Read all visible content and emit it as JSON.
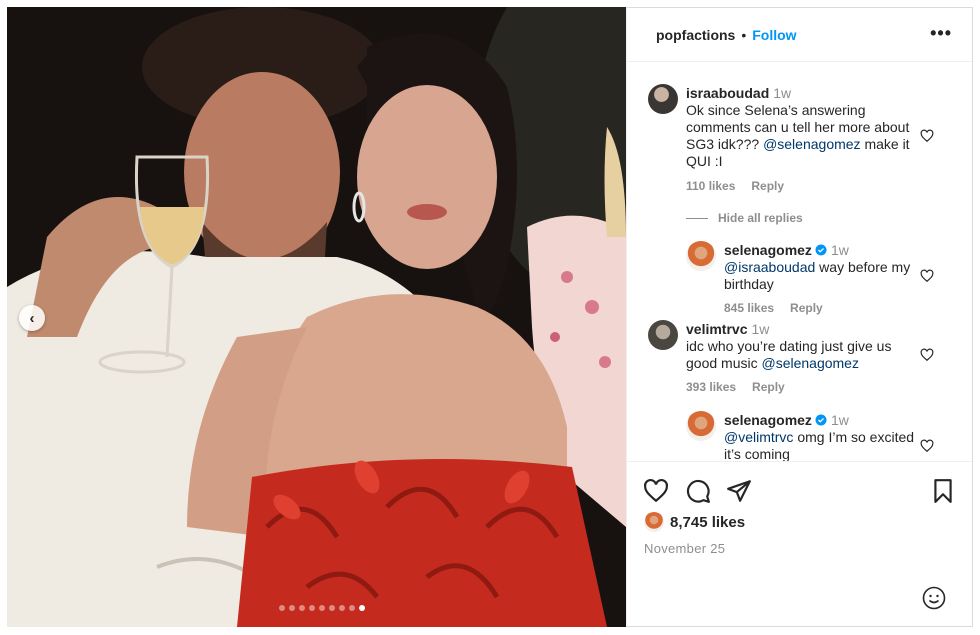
{
  "post": {
    "author": "popfactions",
    "separator": "•",
    "follow_label": "Follow",
    "more_icon": "more-horizontal-icon",
    "carousel": {
      "slides": 9,
      "active_index": 8
    }
  },
  "comments": [
    {
      "user": "israaboudad",
      "time": "1w",
      "text_before": "Ok since Selena’s answering comments can u tell her more about SG3 idk??? ",
      "mention": "@selenagomez",
      "text_after": " make it QUI :I",
      "likes": "110 likes",
      "reply_label": "Reply"
    },
    {
      "user": "selenagomez",
      "verified": true,
      "time": "1w",
      "mention": "@israaboudad",
      "text_after": " way before my birthday",
      "likes": "845 likes",
      "reply_label": "Reply"
    },
    {
      "user": "velimtrvc",
      "time": "1w",
      "text_before": "idc who you’re dating just give us good music ",
      "mention": "@selenagomez",
      "likes": "393 likes",
      "reply_label": "Reply"
    },
    {
      "user": "selenagomez",
      "verified": true,
      "time": "1w",
      "mention": "@velimtrvc",
      "text_after": " omg I’m so excited it’s coming"
    }
  ],
  "hide_replies_label": "Hide all replies",
  "actions": {
    "like_icon": "heart-icon",
    "comment_icon": "comment-icon",
    "share_icon": "share-icon",
    "save_icon": "bookmark-icon"
  },
  "likes_total": "8,745 likes",
  "date": "November 25",
  "emoji_icon": "emoji-icon",
  "colors": {
    "link": "#0095f6",
    "mention": "#00376b",
    "muted": "#8e8e8e",
    "text": "#262626",
    "verified": "#0095f6"
  }
}
